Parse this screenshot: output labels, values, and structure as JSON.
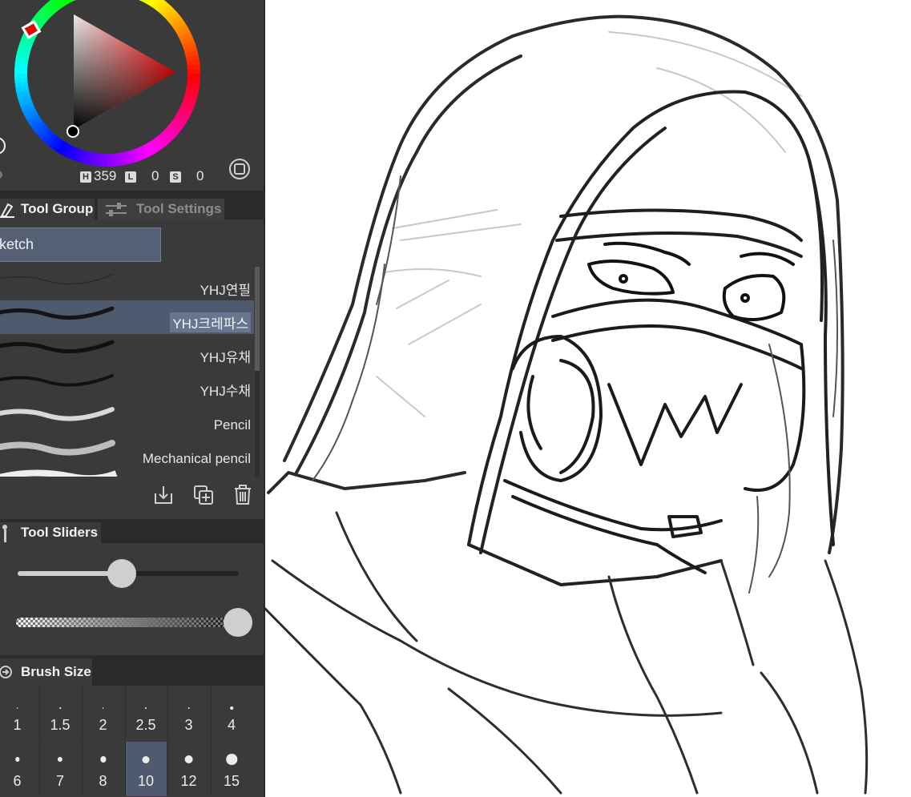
{
  "color_panel": {
    "hue_label": "H",
    "hue_value": "359",
    "lightness_label": "L",
    "lightness_value": "0",
    "saturation_label": "S",
    "saturation_value": "0",
    "current_color": "#ff0000"
  },
  "tabs": {
    "tool_group": "Tool Group",
    "tool_settings": "Tool Settings"
  },
  "tool_group": {
    "selected_group": "ketch",
    "brushes": [
      {
        "label": "YHJ연필",
        "selected": false
      },
      {
        "label": "YHJ크레파스",
        "selected": true
      },
      {
        "label": "YHJ유채",
        "selected": false
      },
      {
        "label": "YHJ수채",
        "selected": false
      },
      {
        "label": "Pencil",
        "selected": false
      },
      {
        "label": "Mechanical pencil",
        "selected": false
      }
    ],
    "actions": [
      "download-icon",
      "duplicate-icon",
      "trash-icon"
    ]
  },
  "tool_sliders": {
    "title": "Tool Sliders",
    "size_fraction": 0.47,
    "opacity_fraction": 1.0
  },
  "brush_size": {
    "title": "Brush Size",
    "sizes": [
      "1",
      "1.5",
      "2",
      "2.5",
      "3",
      "4",
      "6",
      "7",
      "8",
      "10",
      "12",
      "15"
    ],
    "selected": "10"
  },
  "colors": {
    "panel_bg": "#3a3a3a",
    "tab_bg": "#2b2b2b",
    "selection": "#4f5a6f",
    "canvas_bg": "#ffffff"
  }
}
